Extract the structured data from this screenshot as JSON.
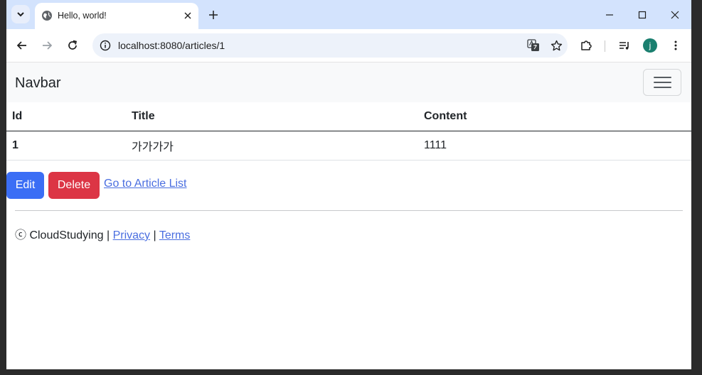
{
  "browser": {
    "tab_title": "Hello, world!",
    "url": "localhost:8080/articles/1",
    "profile_initial": "j"
  },
  "navbar": {
    "brand": "Navbar"
  },
  "table": {
    "headers": [
      "Id",
      "Title",
      "Content"
    ],
    "rows": [
      {
        "id": "1",
        "title": "가가가가",
        "content": "1111"
      }
    ]
  },
  "actions": {
    "edit_label": "Edit",
    "delete_label": "Delete",
    "list_link": "Go to Article List"
  },
  "footer": {
    "copyright": "ⓒ CloudStudying",
    "sep1": "|",
    "privacy": "Privacy",
    "sep2": "|",
    "terms": "Terms"
  },
  "colors": {
    "edit_button": "#3b6ef5",
    "delete_button": "#dc3545",
    "navbar_bg": "#f8f9fa",
    "tabstrip_bg": "#d3e3fd"
  }
}
